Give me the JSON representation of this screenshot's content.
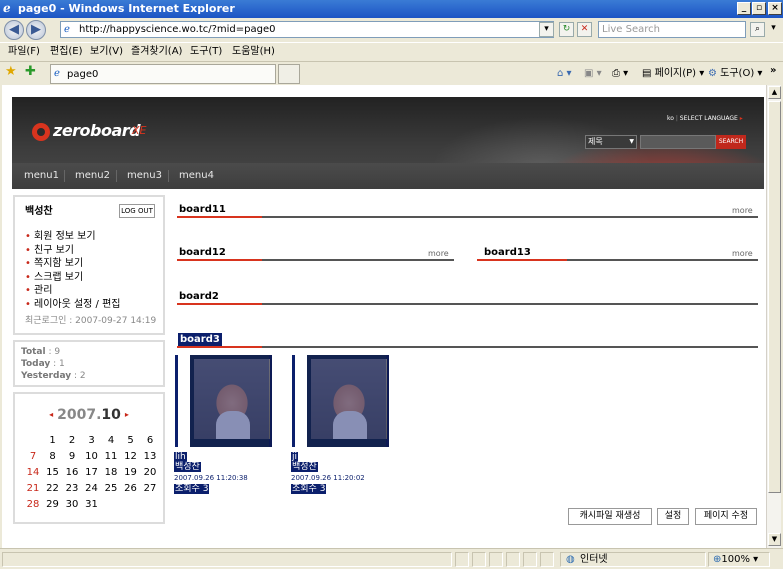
{
  "window": {
    "title": "page0 - Windows Internet Explorer",
    "minimize": "_",
    "maximize": "▫",
    "close": "×"
  },
  "toolbar": {
    "back_icon": "back-arrow-icon",
    "forward_icon": "forward-arrow-icon",
    "address": "http://happyscience.wo.tc/?mid=page0",
    "search_placeholder": "Live Search"
  },
  "menubar": {
    "items": [
      "파일(F)",
      "편집(E)",
      "보기(V)",
      "즐겨찾기(A)",
      "도구(T)",
      "도움말(H)"
    ]
  },
  "favbar": {
    "tab_label": "page0",
    "home_label": "",
    "page_menu": "페이지(P)",
    "tools_menu": "도구(O)",
    "chevron": "»"
  },
  "header": {
    "logo": "zeroboard",
    "logo_suffix": "XE",
    "language": "ko",
    "language_label": "SELECT LANGUAGE",
    "search_select": "제목",
    "search_button": "SEARCH",
    "nav": [
      "menu1",
      "menu2",
      "menu3",
      "menu4"
    ]
  },
  "login": {
    "username": "백성찬",
    "logout": "LOG OUT",
    "items": [
      "회원 정보 보기",
      "친구 보기",
      "쪽지함 보기",
      "스크랩 보기",
      "관리",
      "레이아웃 설정 / 편집"
    ],
    "last_login": "최근로그인 : 2007-09-27 14:19"
  },
  "counter": {
    "total_label": "Total",
    "total": ": 9",
    "today_label": "Today",
    "today": ": 1",
    "yesterday_label": "Yesterday",
    "yesterday": ": 2"
  },
  "calendar": {
    "year": "2007.",
    "month": "10",
    "prev": "◂",
    "next": "▸",
    "weeks": [
      [
        "",
        "1",
        "2",
        "3",
        "4",
        "5",
        "6"
      ],
      [
        "7",
        "8",
        "9",
        "10",
        "11",
        "12",
        "13"
      ],
      [
        "14",
        "15",
        "16",
        "17",
        "18",
        "19",
        "20"
      ],
      [
        "21",
        "22",
        "23",
        "24",
        "25",
        "26",
        "27"
      ],
      [
        "28",
        "29",
        "30",
        "31",
        "",
        "",
        ""
      ]
    ]
  },
  "boards": {
    "board11": "board11",
    "board12": "board12",
    "board13": "board13",
    "board2": "board2",
    "board3": "board3",
    "more": "more"
  },
  "gallery": [
    {
      "line1": "lih",
      "author": "백성찬",
      "date": "2007.09.26 11:20:38",
      "views": "조회수 3"
    },
    {
      "line1": "ji",
      "author": "백성찬",
      "date": "2007.09.26 11:20:02",
      "views": "조회수 3"
    }
  ],
  "buttons": {
    "cache": "캐시파일 재생성",
    "settings": "설정",
    "edit_page": "페이지 수정"
  },
  "status": {
    "zone": "인터넷",
    "zoom": "100%"
  }
}
